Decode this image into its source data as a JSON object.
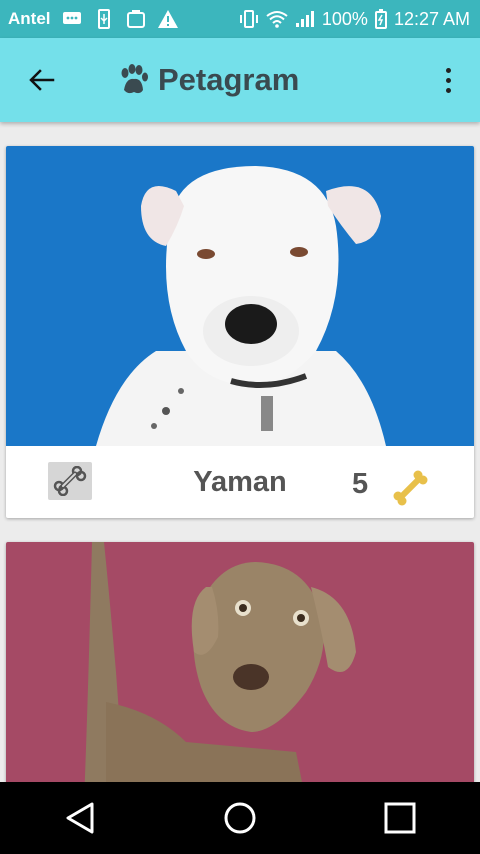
{
  "status_bar": {
    "carrier": "Antel",
    "battery": "100%",
    "time": "12:27 AM"
  },
  "app_bar": {
    "title": "Petagram"
  },
  "pets": [
    {
      "name": "Yaman",
      "likes": "5",
      "background": "#1a77c8"
    },
    {
      "name": "",
      "likes": "",
      "background": "#a54a65"
    }
  ],
  "colors": {
    "status_bar": "#3cb6bd",
    "app_bar": "#74e0ea",
    "bone_like": "#e8c04a"
  }
}
